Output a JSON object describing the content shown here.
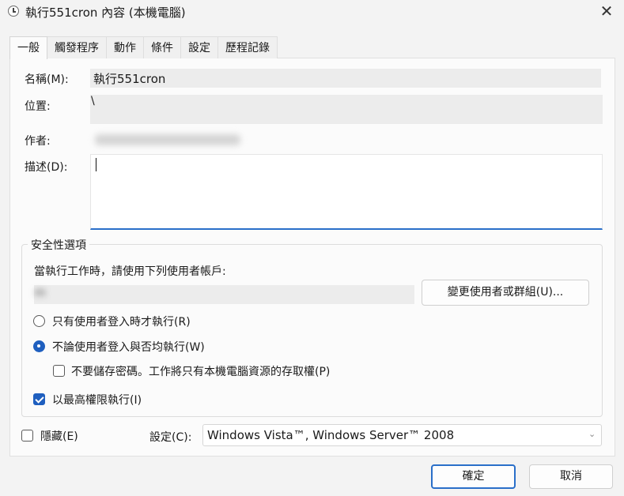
{
  "window": {
    "title": "執行551cron 內容 (本機電腦)",
    "close_glyph": "✕",
    "icon": "clock-icon"
  },
  "tabs": [
    {
      "label": "一般"
    },
    {
      "label": "觸發程序"
    },
    {
      "label": "動作"
    },
    {
      "label": "條件"
    },
    {
      "label": "設定"
    },
    {
      "label": "歷程記錄"
    }
  ],
  "general": {
    "name_label": "名稱(M):",
    "name_value": "執行551cron",
    "location_label": "位置:",
    "location_value": "\\",
    "author_label": "作者:",
    "description_label": "描述(D):",
    "description_value": ""
  },
  "security": {
    "group_title": "安全性選項",
    "run_as_prompt": "當執行工作時，請使用下列使用者帳戶:",
    "account_value": "m",
    "change_user_button": "變更使用者或群組(U)...",
    "radio_logged_on_only": "只有使用者登入時才執行(R)",
    "radio_whether_logged_on": "不論使用者登入與否均執行(W)",
    "dont_store_password": "不要儲存密碼。工作將只有本機電腦資源的存取權(P)",
    "highest_privileges": "以最高權限執行(I)",
    "state": {
      "logged_on_only": false,
      "whether_logged_on": true,
      "dont_store_password": false,
      "highest_privileges": true
    }
  },
  "footer": {
    "hidden_label": "隱藏(E)",
    "hidden_checked": false,
    "configure_label": "設定(C):",
    "configure_value": "Windows Vista™, Windows Server™ 2008",
    "ok_button": "確定",
    "cancel_button": "取消"
  },
  "colors": {
    "accent": "#1f5fbf",
    "focus_border": "#2a6fc9"
  }
}
